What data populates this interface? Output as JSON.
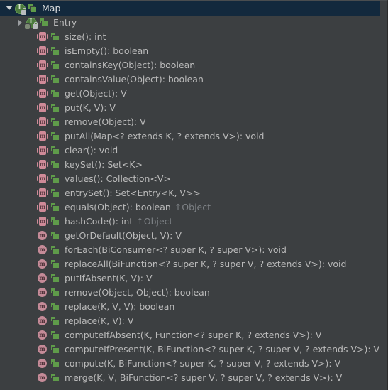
{
  "popup": {
    "title": "Map",
    "selected_row_color": "#13293d",
    "background_color": "#3c3f41",
    "text_color": "#bababa",
    "owner_text_color": "#7d8185",
    "method_abstract_icon_color": "#cf8a98",
    "method_default_icon_color": "#c58b98",
    "interface_icon_color": "#4c7a3e",
    "abstract_badge_color": "#5f9b4a"
  },
  "rows": [
    {
      "label": "Map",
      "kind": "interface",
      "icon_name": "interface-icon",
      "twisty": "expanded",
      "indent": 0,
      "selected": true,
      "abstract_badge": true,
      "lock": true,
      "gear": false,
      "owner": ""
    },
    {
      "label": "Entry",
      "kind": "interface",
      "icon_name": "interface-icon",
      "twisty": "collapsed",
      "indent": 1,
      "selected": false,
      "abstract_badge": true,
      "lock": true,
      "gear": true,
      "owner": ""
    },
    {
      "label": "size(): int",
      "kind": "method-abstract",
      "icon_name": "abstract-method-icon",
      "twisty": "none",
      "indent": 2,
      "selected": false,
      "abstract_badge": true,
      "owner": ""
    },
    {
      "label": "isEmpty(): boolean",
      "kind": "method-abstract",
      "icon_name": "abstract-method-icon",
      "twisty": "none",
      "indent": 2,
      "selected": false,
      "abstract_badge": true,
      "owner": ""
    },
    {
      "label": "containsKey(Object): boolean",
      "kind": "method-abstract",
      "icon_name": "abstract-method-icon",
      "twisty": "none",
      "indent": 2,
      "selected": false,
      "abstract_badge": true,
      "owner": ""
    },
    {
      "label": "containsValue(Object): boolean",
      "kind": "method-abstract",
      "icon_name": "abstract-method-icon",
      "twisty": "none",
      "indent": 2,
      "selected": false,
      "abstract_badge": true,
      "owner": ""
    },
    {
      "label": "get(Object): V",
      "kind": "method-abstract",
      "icon_name": "abstract-method-icon",
      "twisty": "none",
      "indent": 2,
      "selected": false,
      "abstract_badge": true,
      "owner": ""
    },
    {
      "label": "put(K, V): V",
      "kind": "method-abstract",
      "icon_name": "abstract-method-icon",
      "twisty": "none",
      "indent": 2,
      "selected": false,
      "abstract_badge": true,
      "owner": ""
    },
    {
      "label": "remove(Object): V",
      "kind": "method-abstract",
      "icon_name": "abstract-method-icon",
      "twisty": "none",
      "indent": 2,
      "selected": false,
      "abstract_badge": true,
      "owner": ""
    },
    {
      "label": "putAll(Map<? extends K, ? extends V>): void",
      "kind": "method-abstract",
      "icon_name": "abstract-method-icon",
      "twisty": "none",
      "indent": 2,
      "selected": false,
      "abstract_badge": true,
      "owner": ""
    },
    {
      "label": "clear(): void",
      "kind": "method-abstract",
      "icon_name": "abstract-method-icon",
      "twisty": "none",
      "indent": 2,
      "selected": false,
      "abstract_badge": true,
      "owner": ""
    },
    {
      "label": "keySet(): Set<K>",
      "kind": "method-abstract",
      "icon_name": "abstract-method-icon",
      "twisty": "none",
      "indent": 2,
      "selected": false,
      "abstract_badge": true,
      "owner": ""
    },
    {
      "label": "values(): Collection<V>",
      "kind": "method-abstract",
      "icon_name": "abstract-method-icon",
      "twisty": "none",
      "indent": 2,
      "selected": false,
      "abstract_badge": true,
      "owner": ""
    },
    {
      "label": "entrySet(): Set<Entry<K, V>>",
      "kind": "method-abstract",
      "icon_name": "abstract-method-icon",
      "twisty": "none",
      "indent": 2,
      "selected": false,
      "abstract_badge": true,
      "owner": ""
    },
    {
      "label": "equals(Object): boolean",
      "kind": "method-abstract",
      "icon_name": "abstract-method-icon",
      "twisty": "none",
      "indent": 2,
      "selected": false,
      "abstract_badge": true,
      "owner": "↑Object"
    },
    {
      "label": "hashCode(): int",
      "kind": "method-abstract",
      "icon_name": "abstract-method-icon",
      "twisty": "none",
      "indent": 2,
      "selected": false,
      "abstract_badge": true,
      "owner": "↑Object"
    },
    {
      "label": "getOrDefault(Object, V): V",
      "kind": "method-default",
      "icon_name": "default-method-icon",
      "twisty": "none",
      "indent": 2,
      "selected": false,
      "abstract_badge": true,
      "owner": ""
    },
    {
      "label": "forEach(BiConsumer<? super K, ? super V>): void",
      "kind": "method-default",
      "icon_name": "default-method-icon",
      "twisty": "none",
      "indent": 2,
      "selected": false,
      "abstract_badge": true,
      "owner": ""
    },
    {
      "label": "replaceAll(BiFunction<? super K, ? super V, ? extends V>): void",
      "kind": "method-default",
      "icon_name": "default-method-icon",
      "twisty": "none",
      "indent": 2,
      "selected": false,
      "abstract_badge": true,
      "owner": ""
    },
    {
      "label": "putIfAbsent(K, V): V",
      "kind": "method-default",
      "icon_name": "default-method-icon",
      "twisty": "none",
      "indent": 2,
      "selected": false,
      "abstract_badge": true,
      "owner": ""
    },
    {
      "label": "remove(Object, Object): boolean",
      "kind": "method-default",
      "icon_name": "default-method-icon",
      "twisty": "none",
      "indent": 2,
      "selected": false,
      "abstract_badge": true,
      "owner": ""
    },
    {
      "label": "replace(K, V, V): boolean",
      "kind": "method-default",
      "icon_name": "default-method-icon",
      "twisty": "none",
      "indent": 2,
      "selected": false,
      "abstract_badge": true,
      "owner": ""
    },
    {
      "label": "replace(K, V): V",
      "kind": "method-default",
      "icon_name": "default-method-icon",
      "twisty": "none",
      "indent": 2,
      "selected": false,
      "abstract_badge": true,
      "owner": ""
    },
    {
      "label": "computeIfAbsent(K, Function<? super K, ? extends V>): V",
      "kind": "method-default",
      "icon_name": "default-method-icon",
      "twisty": "none",
      "indent": 2,
      "selected": false,
      "abstract_badge": true,
      "owner": ""
    },
    {
      "label": "computeIfPresent(K, BiFunction<? super K, ? super V, ? extends V>): V",
      "kind": "method-default",
      "icon_name": "default-method-icon",
      "twisty": "none",
      "indent": 2,
      "selected": false,
      "abstract_badge": true,
      "owner": ""
    },
    {
      "label": "compute(K, BiFunction<? super K, ? super V, ? extends V>): V",
      "kind": "method-default",
      "icon_name": "default-method-icon",
      "twisty": "none",
      "indent": 2,
      "selected": false,
      "abstract_badge": true,
      "owner": ""
    },
    {
      "label": "merge(K, V, BiFunction<? super V, ? super V, ? extends V>): V",
      "kind": "method-default",
      "icon_name": "default-method-icon",
      "twisty": "none",
      "indent": 2,
      "selected": false,
      "abstract_badge": true,
      "owner": ""
    }
  ]
}
